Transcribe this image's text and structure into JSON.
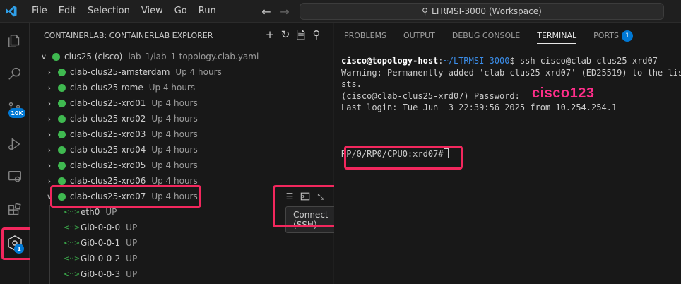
{
  "titlebar": {
    "menu": [
      "File",
      "Edit",
      "Selection",
      "View",
      "Go",
      "Run"
    ],
    "search": "LTRMSI-3000 (Workspace)"
  },
  "activity": {
    "source_control_badge": "10K",
    "containerlab_badge": "1"
  },
  "sidebar": {
    "title": "CONTAINERLAB: CONTAINERLAB EXPLORER",
    "lab": {
      "name": "clus25 (cisco)",
      "path": "lab_1/lab_1-topology.clab.yaml"
    },
    "nodes": [
      {
        "name": "clab-clus25-amsterdam",
        "status": "Up 4 hours"
      },
      {
        "name": "clab-clus25-rome",
        "status": "Up 4 hours"
      },
      {
        "name": "clab-clus25-xrd01",
        "status": "Up 4 hours"
      },
      {
        "name": "clab-clus25-xrd02",
        "status": "Up 4 hours"
      },
      {
        "name": "clab-clus25-xrd03",
        "status": "Up 4 hours"
      },
      {
        "name": "clab-clus25-xrd04",
        "status": "Up 4 hours"
      },
      {
        "name": "clab-clus25-xrd05",
        "status": "Up 4 hours"
      },
      {
        "name": "clab-clus25-xrd06",
        "status": "Up 4 hours"
      },
      {
        "name": "clab-clus25-xrd07",
        "status": "Up 4 hours"
      }
    ],
    "interfaces": [
      {
        "name": "eth0",
        "status": "UP"
      },
      {
        "name": "Gi0-0-0-0",
        "status": "UP"
      },
      {
        "name": "Gi0-0-0-1",
        "status": "UP"
      },
      {
        "name": "Gi0-0-0-2",
        "status": "UP"
      },
      {
        "name": "Gi0-0-0-3",
        "status": "UP"
      }
    ],
    "tooltip": "Connect (SSH)"
  },
  "panel": {
    "tabs": [
      "PROBLEMS",
      "OUTPUT",
      "DEBUG CONSOLE",
      "TERMINAL",
      "PORTS"
    ],
    "ports_badge": "1",
    "terminal": {
      "prompt_user": "cisco@topology-host",
      "prompt_sep": ":",
      "prompt_path": "~/LTRMSI-3000",
      "prompt_cmd": "$ ssh cisco@clab-clus25-xrd07",
      "line2": "Warning: Permanently added 'clab-clus25-xrd07' (ED25519) to the lis",
      "line3": "sts.",
      "line4": "(cisco@clab-clus25-xrd07) Password:",
      "line5": "Last login: Tue Jun  3 22:39:56 2025 from 10.254.254.1",
      "router_prompt": "RP/0/RP0/CPU0:xrd07#",
      "password_note": "cisco123"
    }
  },
  "colors": {
    "accent": "#0078d4",
    "highlight": "#f2275d",
    "status_green": "#3fb950"
  }
}
